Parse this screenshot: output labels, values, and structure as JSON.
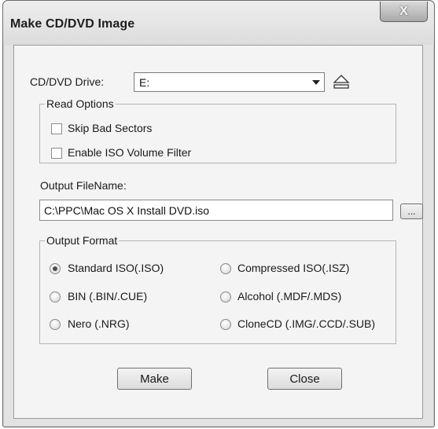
{
  "window": {
    "title": "Make CD/DVD Image",
    "close_glyph": "X"
  },
  "drive": {
    "label": "CD/DVD Drive:",
    "selected": "E:"
  },
  "read_options": {
    "legend": "Read Options",
    "items": [
      {
        "label": "Skip Bad Sectors",
        "checked": false
      },
      {
        "label": "Enable ISO Volume Filter",
        "checked": false
      }
    ]
  },
  "output": {
    "label": "Output FileName:",
    "value": "C:\\PPC\\Mac OS X Install DVD.iso",
    "browse_label": "..."
  },
  "format": {
    "legend": "Output Format",
    "options": [
      {
        "label": "Standard ISO(.ISO)",
        "selected": true
      },
      {
        "label": "Compressed ISO(.ISZ)",
        "selected": false
      },
      {
        "label": "BIN (.BIN/.CUE)",
        "selected": false
      },
      {
        "label": "Alcohol (.MDF/.MDS)",
        "selected": false
      },
      {
        "label": "Nero (.NRG)",
        "selected": false
      },
      {
        "label": "CloneCD (.IMG/.CCD/.SUB)",
        "selected": false
      }
    ]
  },
  "buttons": {
    "make": "Make",
    "close": "Close"
  }
}
